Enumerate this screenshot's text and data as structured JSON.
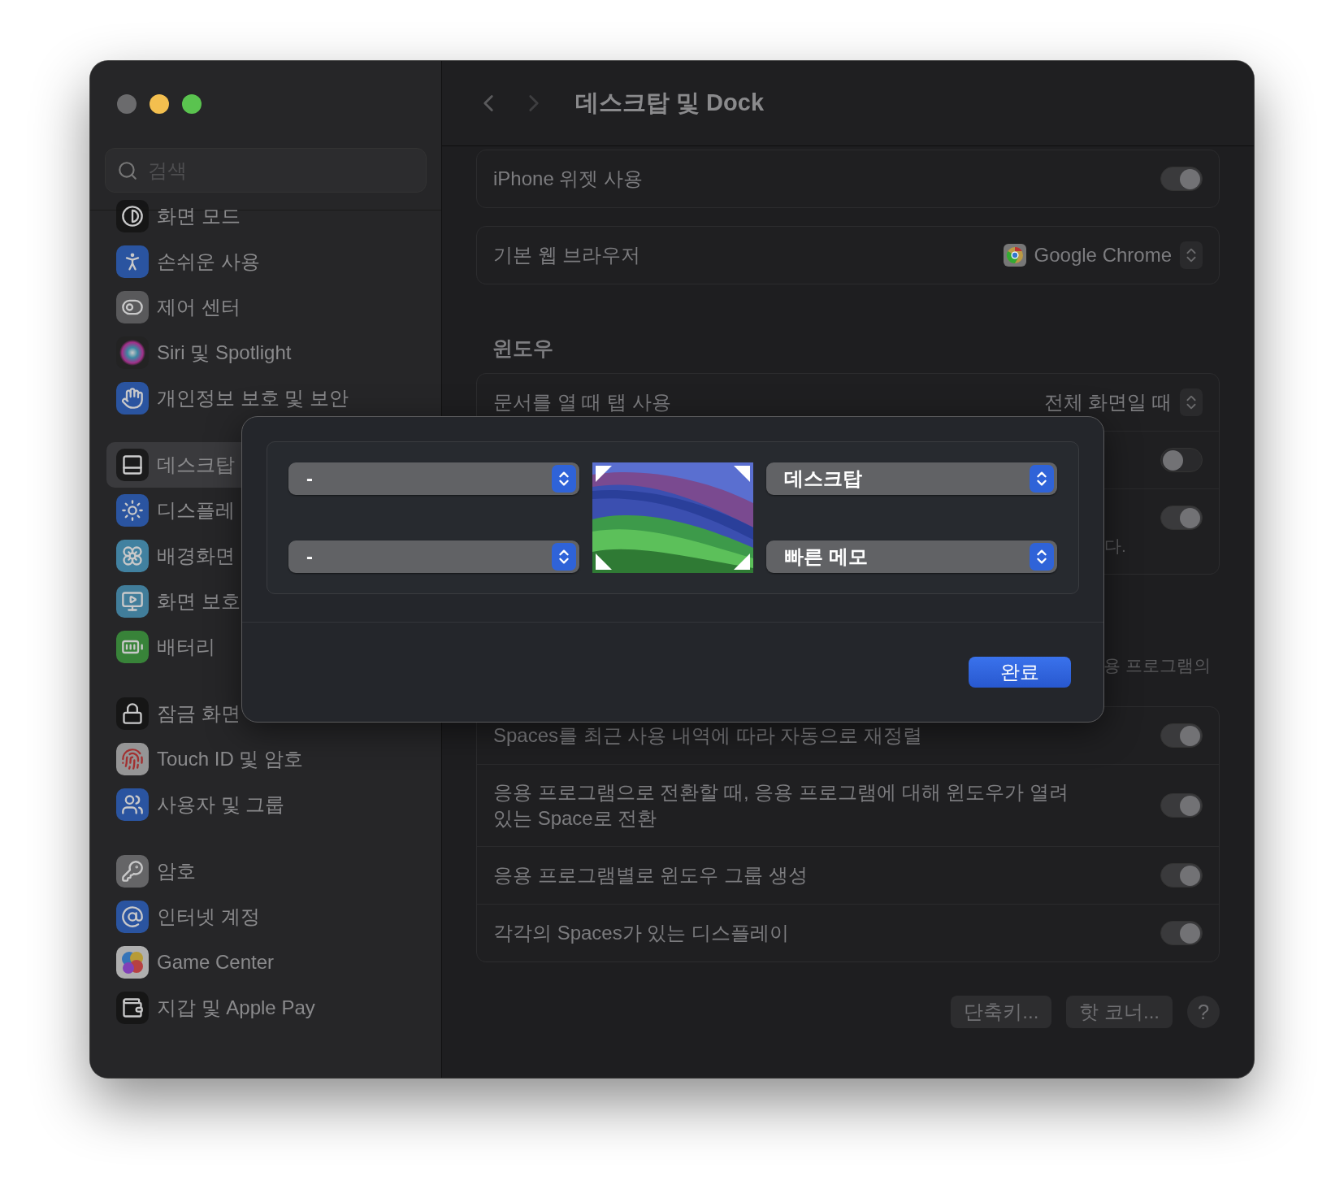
{
  "title": "데스크탑 및 Dock",
  "sidebar": {
    "search": {
      "placeholder": "검색"
    },
    "groups": [
      [
        {
          "label": "화면 모드",
          "selected": false
        },
        {
          "label": "손쉬운 사용",
          "selected": false
        },
        {
          "label": "제어 센터",
          "selected": false
        },
        {
          "label": "Siri 및 Spotlight",
          "selected": false
        },
        {
          "label": "개인정보 보호 및 보안",
          "selected": false
        }
      ],
      [
        {
          "label": "데스크탑",
          "selected": true
        },
        {
          "label": "디스플레",
          "selected": false
        },
        {
          "label": "배경화면",
          "selected": false
        },
        {
          "label": "화면 보호",
          "selected": false
        },
        {
          "label": "배터리",
          "selected": false
        }
      ],
      [
        {
          "label": "잠금 화면",
          "selected": false
        },
        {
          "label": "Touch ID 및 암호",
          "selected": false
        },
        {
          "label": "사용자 및 그룹",
          "selected": false
        }
      ],
      [
        {
          "label": "암호",
          "selected": false
        },
        {
          "label": "인터넷 계정",
          "selected": false
        },
        {
          "label": "Game Center",
          "selected": false
        },
        {
          "label": "지갑 및 Apple Pay",
          "selected": false
        }
      ]
    ]
  },
  "sections": [
    {
      "rows": [
        {
          "kind": "toggle",
          "label": "iPhone 위젯 사용",
          "on": true
        }
      ]
    },
    {
      "rows": [
        {
          "kind": "app-select",
          "label": "기본 웹 브라우저",
          "value": "Google Chrome"
        }
      ]
    },
    {
      "header": "윈도우",
      "rows": [
        {
          "kind": "select",
          "label": "문서를 열 때 탭 사용",
          "value": "전체 화면일 때"
        },
        {
          "kind": "toggle",
          "on": false
        },
        {
          "kind": "toggle",
          "on": true,
          "note": "다."
        }
      ]
    },
    {
      "caption": "용 프로그램의",
      "rows": [
        {
          "kind": "toggle",
          "label": "Spaces를 최근 사용 내역에 따라 자동으로 재정렬",
          "on": true
        },
        {
          "kind": "toggle",
          "label": "응용 프로그램으로 전환할 때, 응용 프로그램에 대해 윈도우가 열려 있는 Space로 전환",
          "on": true
        },
        {
          "kind": "toggle",
          "label": "응용 프로그램별로 윈도우 그룹 생성",
          "on": true
        },
        {
          "kind": "toggle",
          "label": "각각의 Spaces가 있는 디스플레이",
          "on": true
        }
      ]
    }
  ],
  "footer": {
    "buttons": [
      "단축키...",
      "핫 코너..."
    ],
    "help": "?"
  },
  "sheet": {
    "corners": [
      {
        "value": "-"
      },
      {
        "value": "데스크탑"
      },
      {
        "value": "-"
      },
      {
        "value": "빠른 메모"
      }
    ],
    "done": "완료"
  }
}
